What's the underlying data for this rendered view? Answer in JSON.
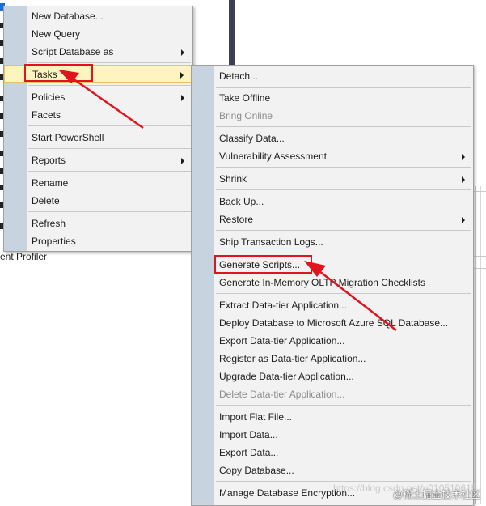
{
  "background": {
    "partial_tree_label": "ent Profiler"
  },
  "context_menu": {
    "items": [
      {
        "label": "New Database...",
        "submenu": false
      },
      {
        "label": "New Query",
        "submenu": false
      },
      {
        "label": "Script Database as",
        "submenu": true
      },
      {
        "label": "Tasks",
        "submenu": true,
        "highlighted": true
      },
      {
        "label": "Policies",
        "submenu": true
      },
      {
        "label": "Facets",
        "submenu": false
      },
      {
        "label": "Start PowerShell",
        "submenu": false
      },
      {
        "label": "Reports",
        "submenu": true
      },
      {
        "label": "Rename",
        "submenu": false
      },
      {
        "label": "Delete",
        "submenu": false
      },
      {
        "label": "Refresh",
        "submenu": false
      },
      {
        "label": "Properties",
        "submenu": false
      }
    ]
  },
  "tasks_submenu": {
    "items": [
      {
        "label": "Detach...",
        "disabled": false
      },
      {
        "label": "Take Offline",
        "disabled": false
      },
      {
        "label": "Bring Online",
        "disabled": true
      },
      {
        "label": "Classify Data...",
        "disabled": false
      },
      {
        "label": "Vulnerability Assessment",
        "disabled": false,
        "submenu": true
      },
      {
        "label": "Shrink",
        "disabled": false,
        "submenu": true
      },
      {
        "label": "Back Up...",
        "disabled": false
      },
      {
        "label": "Restore",
        "disabled": false,
        "submenu": true
      },
      {
        "label": "Ship Transaction Logs...",
        "disabled": false
      },
      {
        "label": "Generate Scripts...",
        "disabled": false,
        "boxed": true
      },
      {
        "label": "Generate In-Memory OLTP Migration Checklists",
        "disabled": false
      },
      {
        "label": "Extract Data-tier Application...",
        "disabled": false
      },
      {
        "label": "Deploy Database to Microsoft Azure SQL Database...",
        "disabled": false
      },
      {
        "label": "Export Data-tier Application...",
        "disabled": false
      },
      {
        "label": "Register as Data-tier Application...",
        "disabled": false
      },
      {
        "label": "Upgrade Data-tier Application...",
        "disabled": false
      },
      {
        "label": "Delete Data-tier Application...",
        "disabled": true
      },
      {
        "label": "Import Flat File...",
        "disabled": false
      },
      {
        "label": "Import Data...",
        "disabled": false
      },
      {
        "label": "Export Data...",
        "disabled": false
      },
      {
        "label": "Copy Database...",
        "disabled": false
      },
      {
        "label": "Manage Database Encryption...",
        "disabled": false
      }
    ]
  },
  "watermark": {
    "csdn_text": "https://blog.csdn.net/u010510615",
    "site_text": "@稀土掘金技术社区"
  },
  "colors": {
    "annotation_red": "#e0141e",
    "menu_gutter": "#c8d3e0",
    "highlight": "#fdf4bf"
  }
}
